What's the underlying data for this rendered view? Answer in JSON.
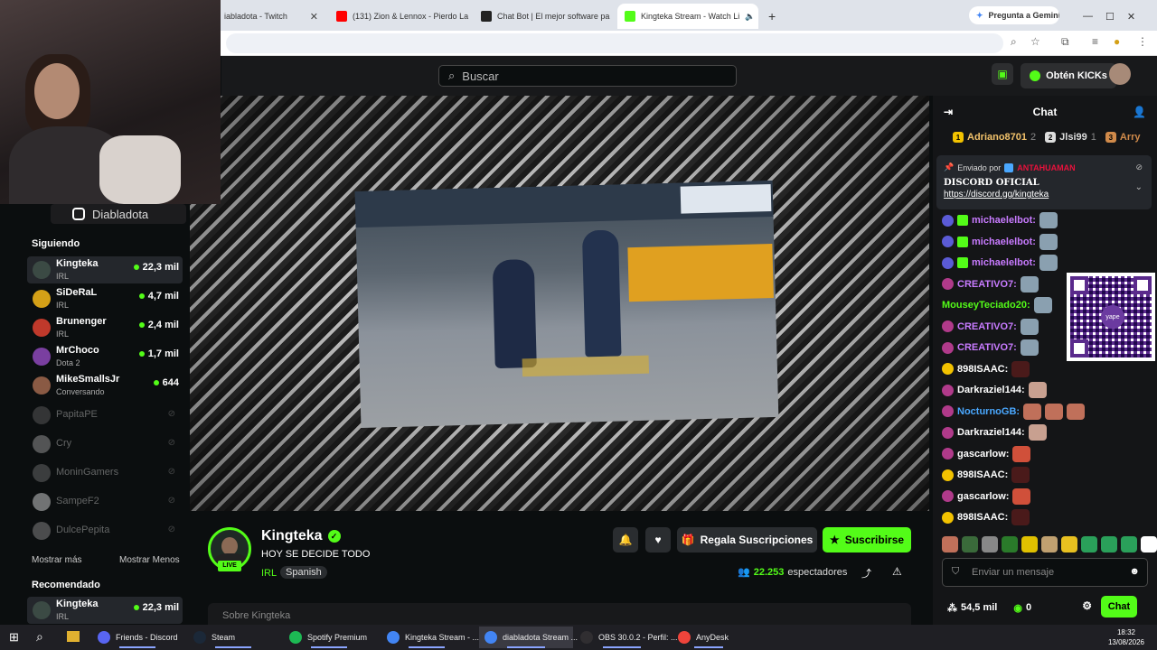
{
  "browser": {
    "tabs": [
      {
        "title": "iabladota - Twitch",
        "favicon_color": "#9146ff"
      },
      {
        "title": "(131) Zion & Lennox - Pierdo La",
        "favicon_color": "#ff0000"
      },
      {
        "title": "Chat Bot | El mejor software pa",
        "favicon_color": "#222222"
      },
      {
        "title": "Kingteka Stream - Watch Li",
        "favicon_color": "#53fc18"
      }
    ],
    "gemini_label": "Pregunta a Gemini"
  },
  "topnav": {
    "search_placeholder": "Buscar",
    "kicks_button": "Obtén KICKs"
  },
  "webcam": {
    "instagram_handle": "Diabladota"
  },
  "sidebar": {
    "following_heading": "Siguiendo",
    "following": [
      {
        "name": "Kingteka",
        "category": "IRL",
        "viewers": "22,3 mil",
        "live": true,
        "avatar_color": "#3b4a44"
      },
      {
        "name": "SiDeRaL",
        "category": "IRL",
        "viewers": "4,7 mil",
        "live": true,
        "avatar_color": "#d4a017"
      },
      {
        "name": "Brunenger",
        "category": "IRL",
        "viewers": "2,4 mil",
        "live": true,
        "avatar_color": "#c0392b"
      },
      {
        "name": "MrChoco",
        "category": "Dota 2",
        "viewers": "1,7 mil",
        "live": true,
        "avatar_color": "#7a3fa0"
      },
      {
        "name": "MikeSmallsJr",
        "category": "Conversando",
        "viewers": "644",
        "live": true,
        "avatar_color": "#8a5a44"
      },
      {
        "name": "PapitaPE",
        "live": false,
        "avatar_color": "#666666"
      },
      {
        "name": "Cry",
        "live": false,
        "avatar_color": "#aaaaaa"
      },
      {
        "name": "MoninGamers",
        "live": false,
        "avatar_color": "#777777"
      },
      {
        "name": "SampeF2",
        "live": false,
        "avatar_color": "#eeeeee"
      },
      {
        "name": "DulcePepita",
        "live": false,
        "avatar_color": "#999999"
      }
    ],
    "show_more": "Mostrar más",
    "show_less": "Mostrar Menos",
    "recommended_heading": "Recomendado",
    "recommended": [
      {
        "name": "Kingteka",
        "category": "IRL",
        "viewers": "22,3 mil",
        "avatar_color": "#3b4a44"
      }
    ]
  },
  "channel": {
    "name": "Kingteka",
    "live_badge": "LIVE",
    "title": "HOY SE DECIDE TODO",
    "category": "IRL",
    "tag": "Spanish",
    "viewers_count": "22.253",
    "viewers_label": "espectadores",
    "gift_button": "Regala Suscripciones",
    "subscribe_button": "Suscribirse",
    "about_preview": "Sobre Kingteka"
  },
  "chat": {
    "title": "Chat",
    "leaderboard": [
      {
        "name": "Adriano8701",
        "count": "2",
        "color": "#f2c26b"
      },
      {
        "name": "Jlsi99",
        "count": "1",
        "color": "#dddddd"
      },
      {
        "name": "Arry",
        "count": "",
        "color": "#d08a4a"
      }
    ],
    "pinned": {
      "sent_by_label": "Enviado por",
      "sent_by": "ANTAHUAMAN",
      "line1": "DISCORD OFICIAL",
      "line2": "https://discord.gg/kingteka"
    },
    "messages": [
      {
        "user": "michaelelbot:",
        "color": "#c87bff",
        "badge": "#5b5bd6",
        "mod": true,
        "emotes": [
          "#8aa0b0"
        ]
      },
      {
        "user": "michaelelbot:",
        "color": "#c87bff",
        "badge": "#5b5bd6",
        "mod": true,
        "emotes": [
          "#8aa0b0"
        ]
      },
      {
        "user": "michaelelbot:",
        "color": "#c87bff",
        "badge": "#5b5bd6",
        "mod": true,
        "emotes": [
          "#8aa0b0"
        ]
      },
      {
        "user": "CREATIVO7:",
        "color": "#c87bff",
        "badge": "#b03a8a",
        "mod": false,
        "emotes": [
          "#8aa0b0"
        ]
      },
      {
        "user": "MouseyTeciado20:",
        "color": "#53fc18",
        "badge": "",
        "mod": false,
        "emotes": [
          "#8aa0b0"
        ]
      },
      {
        "user": "CREATIVO7:",
        "color": "#c87bff",
        "badge": "#b03a8a",
        "mod": false,
        "emotes": [
          "#8aa0b0"
        ]
      },
      {
        "user": "CREATIVO7:",
        "color": "#c87bff",
        "badge": "#b03a8a",
        "mod": false,
        "emotes": [
          "#8aa0b0"
        ]
      },
      {
        "user": "898ISAAC:",
        "color": "#ffffff",
        "badge": "#f2c200",
        "mod": false,
        "emotes": [
          "#4a1a1a"
        ]
      },
      {
        "user": "Darkraziel144:",
        "color": "#ffffff",
        "badge": "#b03a8a",
        "mod": false,
        "emotes": [
          "#c8a090"
        ]
      },
      {
        "user": "NocturnoGB:",
        "color": "#4aa8ff",
        "badge": "#b03a8a",
        "mod": false,
        "emotes": [
          "#c0705a",
          "#c0705a",
          "#c0705a"
        ]
      },
      {
        "user": "Darkraziel144:",
        "color": "#ffffff",
        "badge": "#b03a8a",
        "mod": false,
        "emotes": [
          "#c8a090"
        ]
      },
      {
        "user": "gascarlow:",
        "color": "#ffffff",
        "badge": "#b03a8a",
        "mod": false,
        "emotes": [
          "#d0503a"
        ]
      },
      {
        "user": "898ISAAC:",
        "color": "#ffffff",
        "badge": "#f2c200",
        "mod": false,
        "emotes": [
          "#4a1a1a"
        ]
      },
      {
        "user": "gascarlow:",
        "color": "#ffffff",
        "badge": "#b03a8a",
        "mod": false,
        "emotes": [
          "#d0503a"
        ]
      },
      {
        "user": "898ISAAC:",
        "color": "#ffffff",
        "badge": "#f2c200",
        "mod": false,
        "emotes": [
          "#4a1a1a"
        ]
      }
    ],
    "emote_bar_colors": [
      "#c0705a",
      "#3a6a3a",
      "#888888",
      "#2a7a2a",
      "#e0c000",
      "#c0a070",
      "#e8c020",
      "#2aa05a",
      "#2aa05a",
      "#2aa05a",
      "#ffffff"
    ],
    "input_placeholder": "Enviar un mensaje",
    "kicks_balance": "54,5 mil",
    "points": "0",
    "send_button": "Chat"
  },
  "taskbar": {
    "apps": [
      {
        "label": "Friends - Discord",
        "icon_color": "#5865f2"
      },
      {
        "label": "Steam",
        "icon_color": "#1b2838"
      },
      {
        "label": "Spotify Premium",
        "icon_color": "#1db954"
      },
      {
        "label": "Kingteka Stream - ...",
        "icon_color": "#4285f4"
      },
      {
        "label": "diabladota Stream ...",
        "icon_color": "#4285f4"
      },
      {
        "label": "OBS 30.0.2 - Perfil: ...",
        "icon_color": "#302e31"
      },
      {
        "label": "AnyDesk",
        "icon_color": "#ef443b"
      }
    ],
    "time": "18:32",
    "date": "13/08/2026"
  },
  "colors": {
    "kick_green": "#53fc18",
    "background": "#0b0e0f",
    "panel": "#18191b"
  }
}
